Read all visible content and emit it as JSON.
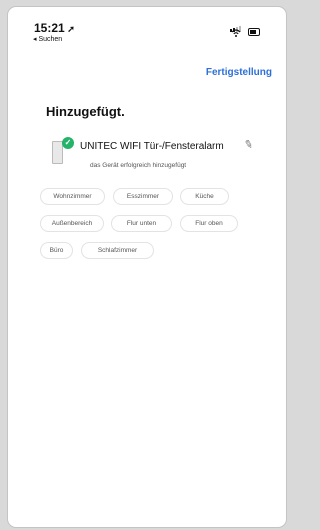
{
  "status": {
    "time": "15:21"
  },
  "nav": {
    "back_label": "◂ Suchen",
    "done_label": "Fertigstellung"
  },
  "page": {
    "title": "Hinzugefügt."
  },
  "device": {
    "name": "UNITEC WIFI Tür-/Fensteralarm",
    "status_text": "das Gerät erfolgreich hinzugefügt"
  },
  "rooms": [
    "Wohnzimmer",
    "Esszimmer",
    "Küche",
    "Außenbereich",
    "Flur unten",
    "Flur oben",
    "Büro",
    "Schlafzimmer"
  ],
  "icons": {
    "location": "location-arrow-icon",
    "signal": "cellular-signal-icon",
    "wifi": "wifi-icon",
    "battery": "battery-icon",
    "check": "check-circle-icon",
    "edit": "pencil-icon"
  },
  "colors": {
    "accent": "#2d6fd9",
    "success": "#25b36a"
  }
}
